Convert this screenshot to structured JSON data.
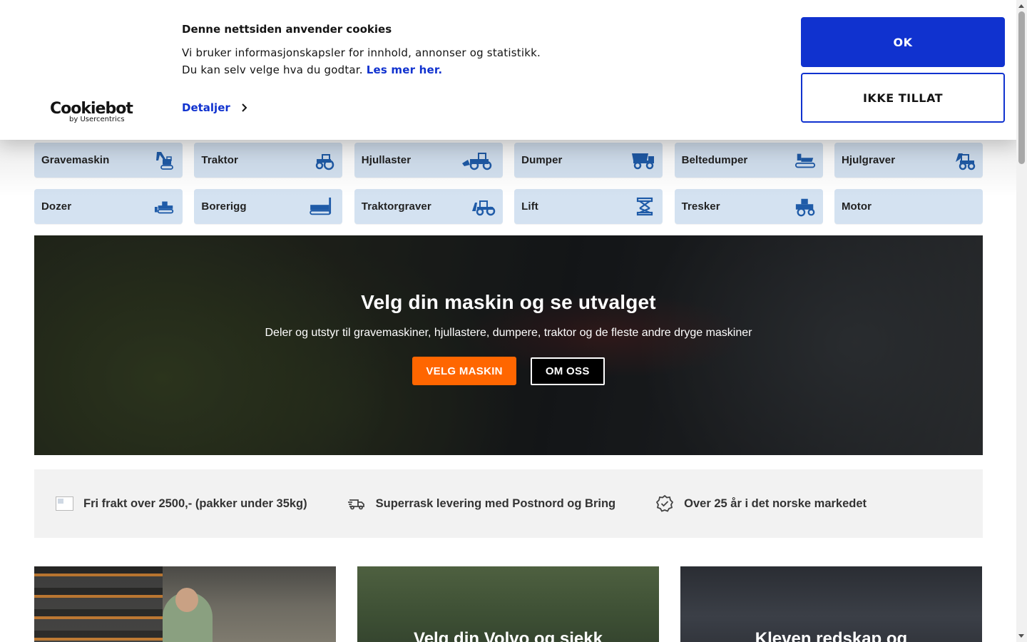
{
  "cookie_banner": {
    "title": "Denne nettsiden anvender cookies",
    "text_line1": "Vi bruker informasjonskapsler for innhold, annonser og statistikk.",
    "text_line2": "Du kan selv velge hva du godtar.",
    "read_more": "Les mer her.",
    "details_label": "Detaljer",
    "ok_label": "OK",
    "deny_label": "IKKE TILLAT",
    "logo_main": "Cookiebot",
    "logo_sub": "by Usercentrics",
    "accent_color": "#1032cf"
  },
  "categories": [
    {
      "label": "Gravemaskin",
      "icon": "excavator-icon"
    },
    {
      "label": "Traktor",
      "icon": "tractor-icon"
    },
    {
      "label": "Hjullaster",
      "icon": "wheel-loader-icon"
    },
    {
      "label": "Dumper",
      "icon": "dumper-icon"
    },
    {
      "label": "Beltedumper",
      "icon": "track-dumper-icon"
    },
    {
      "label": "Hjulgraver",
      "icon": "wheel-excavator-icon"
    },
    {
      "label": "Dozer",
      "icon": "dozer-icon"
    },
    {
      "label": "Borerigg",
      "icon": "drill-rig-icon"
    },
    {
      "label": "Traktorgraver",
      "icon": "backhoe-icon"
    },
    {
      "label": "Lift",
      "icon": "scissor-lift-icon"
    },
    {
      "label": "Tresker",
      "icon": "combine-harvester-icon"
    },
    {
      "label": "Motor",
      "icon": ""
    }
  ],
  "hero": {
    "title": "Velg din maskin og se utvalget",
    "subtitle": "Deler og utstyr til gravemaskiner, hjullastere, dumpere, traktor og de fleste andre dryge maskiner",
    "primary_button": "VELG MASKIN",
    "secondary_button": "OM OSS",
    "primary_color": "#ff6600"
  },
  "usp": [
    {
      "text": "Fri frakt over 2500,- (pakker under 35kg)",
      "icon": "broken-image-icon"
    },
    {
      "text": "Superrask levering med Postnord og Bring",
      "icon": "delivery-truck-icon"
    },
    {
      "text": "Over 25 år i det norske markedet",
      "icon": "verified-badge-icon"
    }
  ],
  "cards": [
    {
      "title": ""
    },
    {
      "title": "Velg din Volvo og sjekk"
    },
    {
      "title": "Kleven redskap og"
    }
  ]
}
